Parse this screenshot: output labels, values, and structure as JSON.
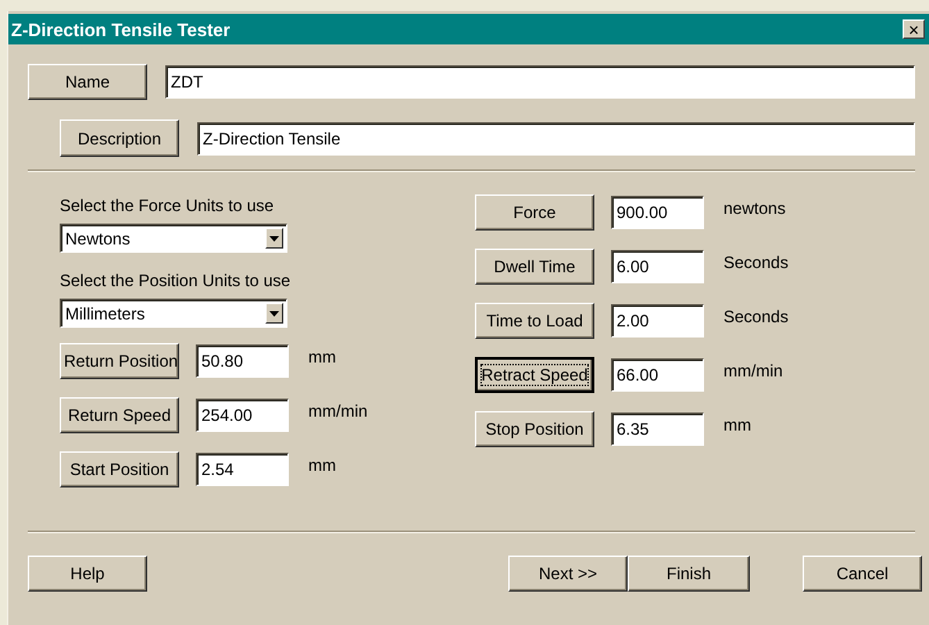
{
  "window": {
    "title": "Z-Direction Tensile Tester",
    "close": "×"
  },
  "name": {
    "button": "Name",
    "value": "ZDT"
  },
  "description": {
    "button": "Description",
    "value": "Z-Direction Tensile"
  },
  "force_units": {
    "label": "Select the Force Units to use",
    "value": "Newtons"
  },
  "position_units": {
    "label": "Select the Position Units to use",
    "value": "Millimeters"
  },
  "left_params": [
    {
      "button": "Return Position",
      "value": "50.80",
      "unit": "mm",
      "focused": false
    },
    {
      "button": "Return Speed",
      "value": "254.00",
      "unit": "mm/min",
      "focused": false
    },
    {
      "button": "Start Position",
      "value": "2.54",
      "unit": "mm",
      "focused": false
    }
  ],
  "right_params": [
    {
      "button": "Force",
      "value": "900.00",
      "unit": "newtons",
      "focused": false
    },
    {
      "button": "Dwell Time",
      "value": "6.00",
      "unit": "Seconds",
      "focused": false
    },
    {
      "button": "Time to Load",
      "value": "2.00",
      "unit": "Seconds",
      "focused": false
    },
    {
      "button": "Retract Speed",
      "value": "66.00",
      "unit": "mm/min",
      "focused": true
    },
    {
      "button": "Stop Position",
      "value": "6.35",
      "unit": "mm",
      "focused": false
    }
  ],
  "buttons": {
    "help": "Help",
    "next": "Next >>",
    "finish": "Finish",
    "cancel": "Cancel"
  }
}
